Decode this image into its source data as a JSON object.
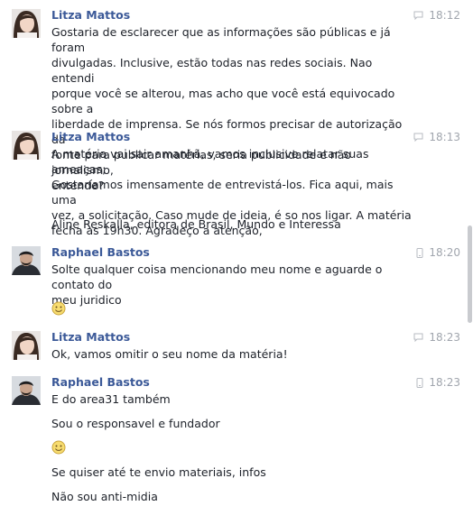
{
  "messages": [
    {
      "sender": "Litza Mattos",
      "time": "18:12",
      "device": "chat-bubble-icon",
      "lines": [
        "Gostaria de esclarecer que as informações são públicas e já foram",
        "divulgadas. Inclusive, estão todas nas redes sociais. Nao entendi",
        "porque você se alterou, mas acho que você está equivocado sobre a",
        "liberdade de imprensa.  Se nós formos precisar de autorização da",
        "fonte para publicar matérias, seria publicidade e não jornalismo,",
        "entende?"
      ]
    },
    {
      "sender": "Litza Mattos",
      "time": "18:13",
      "device": "chat-bubble-icon",
      "lines": [
        "A matéria vai sair amanhã, vamos inclusive relatar suas ameaças;",
        "Gostaríamos imensamente de entrevistá-los. Fica aqui, mais uma",
        "vez, a solicitação. Caso mude de ideia, é so nos ligar. A matéria",
        "fecha às 19h30. Agradeço a atenção,"
      ],
      "extra": "Aline Reskalla, editora de Brasil, Mundo e Interessa"
    },
    {
      "sender": "Raphael Bastos",
      "time": "18:20",
      "device": "mobile-phone-icon",
      "lines": [
        "Solte qualquer coisa mencionando meu nome e aguarde o contato do",
        "meu juridico"
      ]
    },
    {
      "sender": "Litza Mattos",
      "time": "18:23",
      "device": "chat-bubble-icon",
      "lines": [
        "Ok, vamos omitir o seu nome da matéria!"
      ]
    },
    {
      "sender": "Raphael Bastos",
      "time": "18:23",
      "device": "mobile-phone-icon",
      "lines": [
        "E do area31 também"
      ],
      "followups": [
        "Sou o responsavel e fundador",
        "Se quiser até te envio materiais, infos",
        "Não sou anti-midia"
      ]
    }
  ],
  "emoji": "smiley-emoji-icon"
}
